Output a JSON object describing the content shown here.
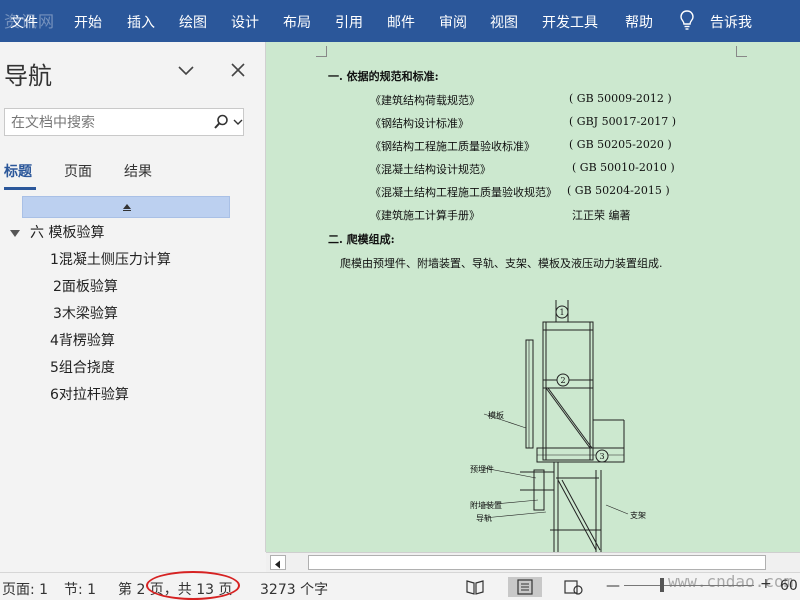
{
  "ribbon": {
    "watermark": "资讯网",
    "tabs": [
      "文件",
      "开始",
      "插入",
      "绘图",
      "设计",
      "布局",
      "引用",
      "邮件",
      "审阅",
      "视图",
      "开发工具",
      "帮助"
    ],
    "tell_me": "告诉我"
  },
  "nav": {
    "title": "导航",
    "search_placeholder": "在文档中搜索",
    "tabs": [
      "标题",
      "页面",
      "结果"
    ],
    "tree": {
      "root": "六 模板验算",
      "items": [
        "1混凝土侧压力计算",
        "2面板验算",
        "3木梁验算",
        "4背楞验算",
        "5组合挠度",
        "6对拉杆验算"
      ]
    }
  },
  "doc": {
    "heading1": "一. 依据的规范和标准:",
    "standards": [
      {
        "name": "《建筑结构荷载规范》",
        "code": "( GB 50009-2012 )"
      },
      {
        "name": "《钢结构设计标准》",
        "code": "( GBJ 50017-2017 )"
      },
      {
        "name": "《钢结构工程施工质量验收标准》",
        "code": "( GB 50205-2020 )"
      },
      {
        "name": "《混凝土结构设计规范》",
        "code": "( GB 50010-2010 )"
      },
      {
        "name": "《混凝土结构工程施工质量验收规范》",
        "code": "( GB 50204-2015 )"
      },
      {
        "name": "《建筑施工计算手册》",
        "code": "江正荣   编著"
      }
    ],
    "heading2": "二. 爬模组成:",
    "paragraph": "爬模由预埋件、附墙装置、导轨、支架、模板及液压动力装置组成.",
    "drawing": {
      "labels": {
        "c1": "1",
        "c2": "2",
        "c3": "3",
        "formwork": "模板",
        "embed": "预埋件",
        "wall_device": "附墙装置",
        "guide": "导轨",
        "support": "支架"
      }
    }
  },
  "status": {
    "page": "页面: 1",
    "section": "节: 1",
    "page_count": "第 2 页，共 13 页",
    "word_count": "3273 个字",
    "watermark": "www.cndao.com",
    "zoom": "60"
  }
}
